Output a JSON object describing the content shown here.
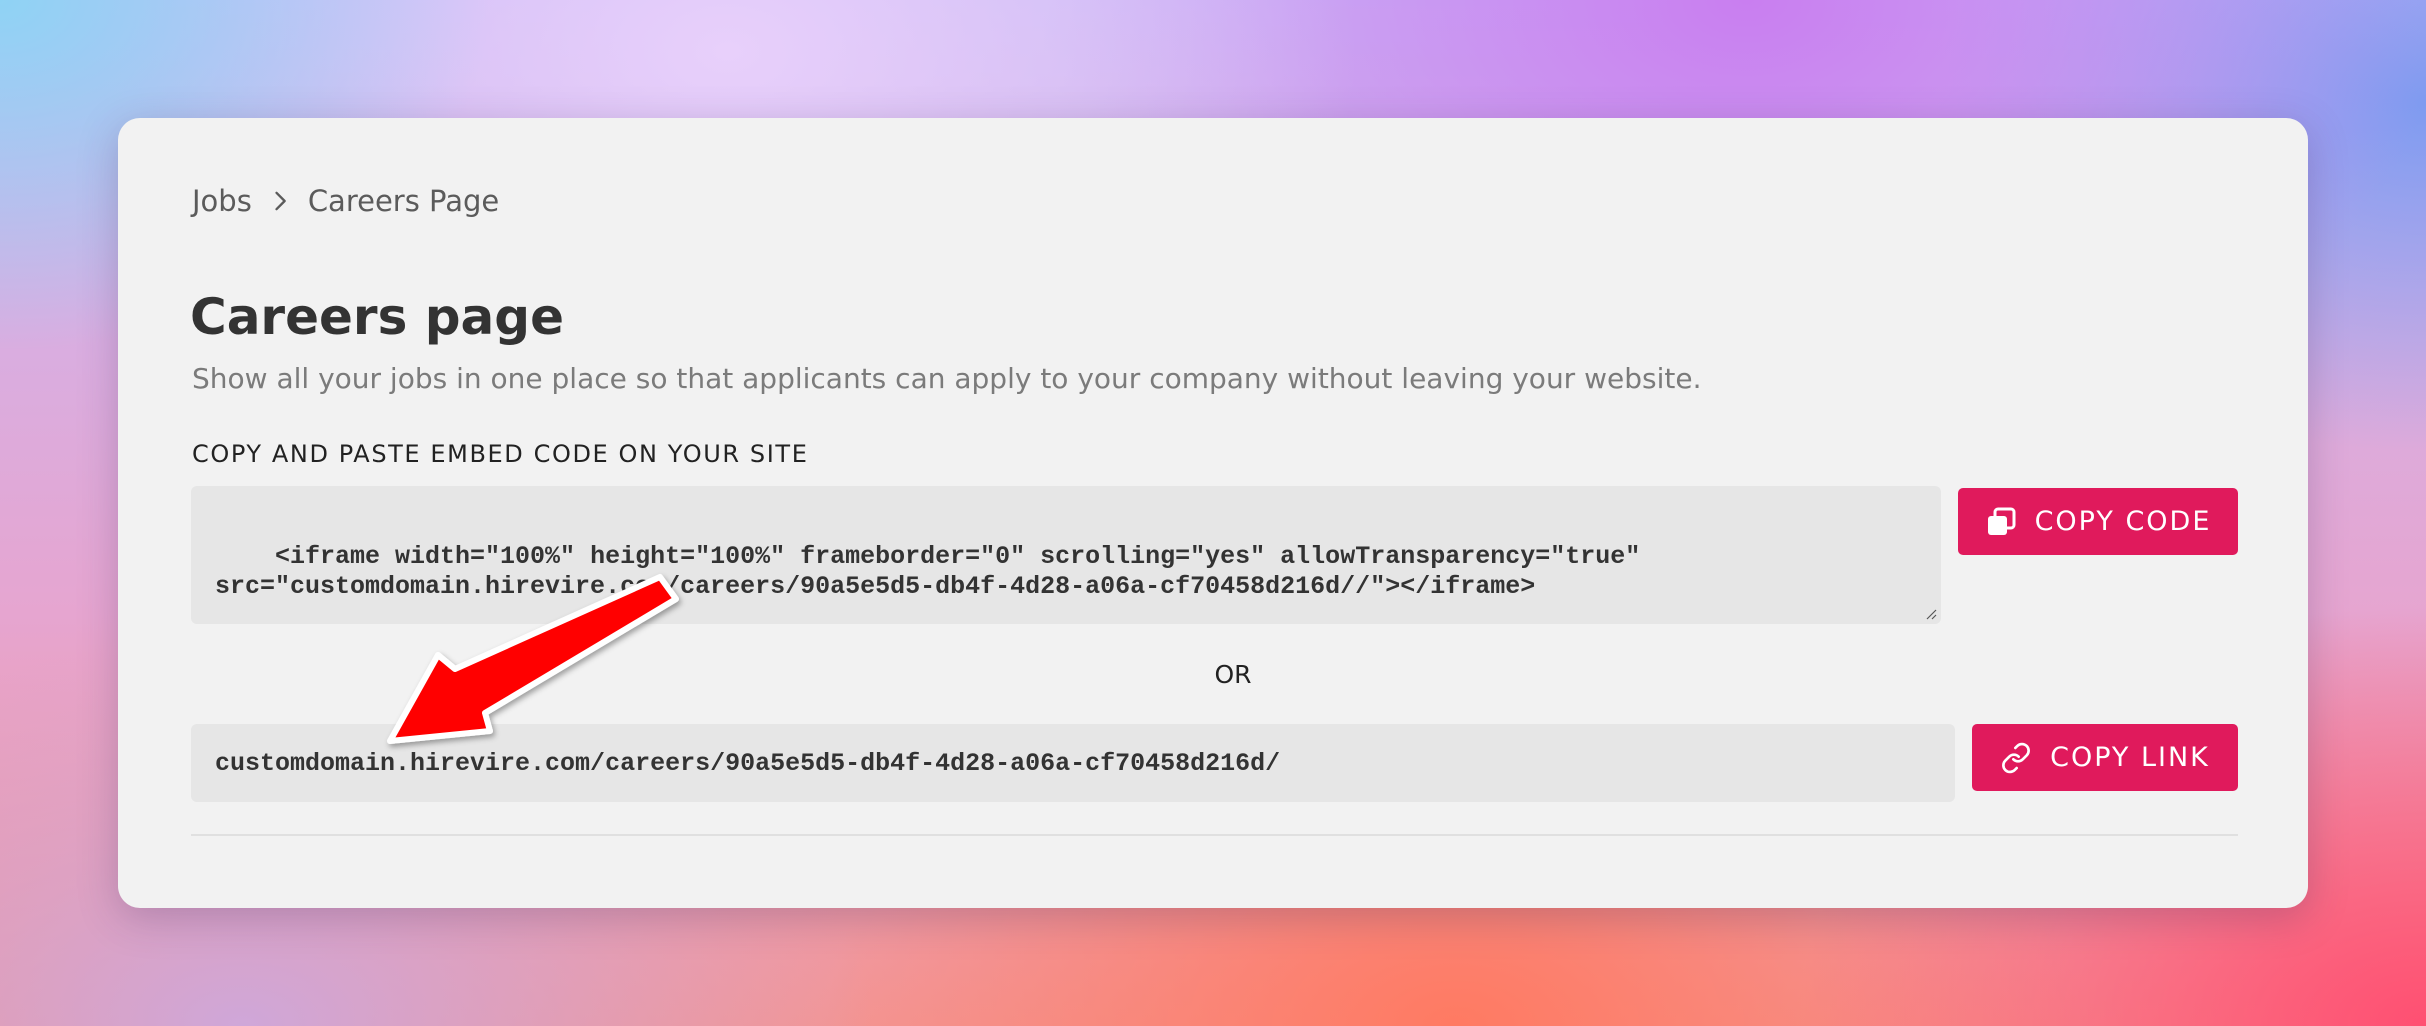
{
  "breadcrumb": {
    "items": [
      "Jobs",
      "Careers Page"
    ]
  },
  "header": {
    "title": "Careers page",
    "subtitle": "Show all your jobs in one place so that applicants can apply to your company without leaving your website."
  },
  "embed": {
    "section_label": "COPY AND PASTE EMBED CODE ON YOUR SITE",
    "code": "<iframe width=\"100%\" height=\"100%\" frameborder=\"0\" scrolling=\"yes\" allowTransparency=\"true\"\nsrc=\"customdomain.hirevire.com/careers/90a5e5d5-db4f-4d28-a06a-cf70458d216d//\"></iframe>",
    "copy_code_label": "COPY CODE"
  },
  "or_label": "OR",
  "link": {
    "url": "customdomain.hirevire.com/careers/90a5e5d5-db4f-4d28-a06a-cf70458d216d/",
    "copy_link_label": "COPY LINK"
  },
  "colors": {
    "accent": "#e01a5c",
    "annotation_arrow": "#ff0000",
    "card_bg": "#f2f2f2",
    "field_bg": "#e6e6e6"
  },
  "icons": {
    "breadcrumb_separator": "chevron-right-icon",
    "copy_code": "copy-icon",
    "copy_link": "link-icon"
  }
}
